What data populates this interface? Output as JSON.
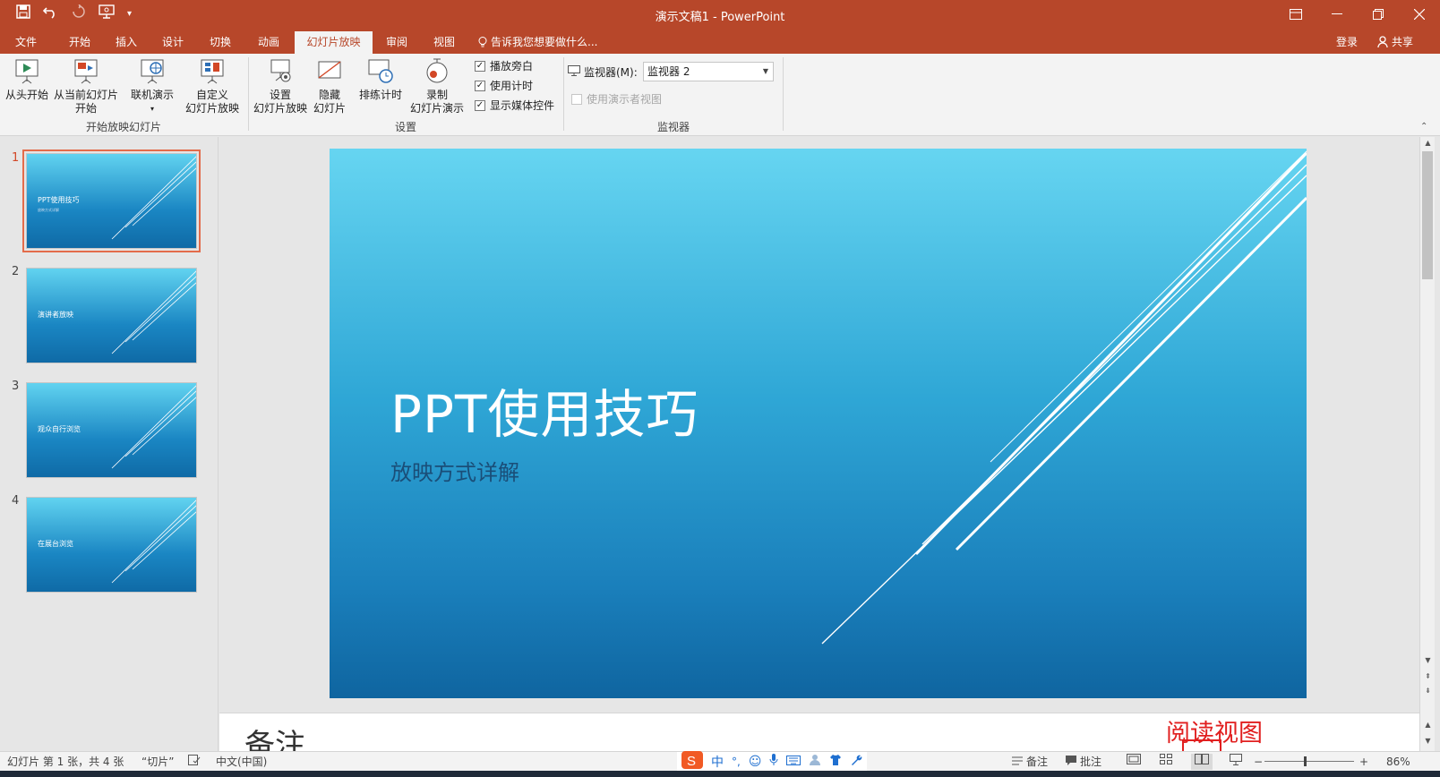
{
  "window": {
    "title": "演示文稿1 - PowerPoint",
    "qat_icons": [
      "save-icon",
      "undo-icon",
      "redo-icon",
      "present-icon",
      "customize-qat-icon"
    ]
  },
  "tabs": {
    "items": [
      "文件",
      "开始",
      "插入",
      "设计",
      "切换",
      "动画",
      "幻灯片放映",
      "审阅",
      "视图"
    ],
    "active": "幻灯片放映",
    "tell_me": "告诉我您想要做什么...",
    "login": "登录",
    "share": "共享"
  },
  "ribbon": {
    "group_start": {
      "label": "开始放映幻灯片",
      "from_beginning": "从头开始",
      "from_current_line1": "从当前幻灯片",
      "from_current_line2": "开始",
      "online": "联机演示",
      "custom_line1": "自定义",
      "custom_line2": "幻灯片放映"
    },
    "group_setup": {
      "label": "设置",
      "setup_line1": "设置",
      "setup_line2": "幻灯片放映",
      "hide_line1": "隐藏",
      "hide_line2": "幻灯片",
      "rehearse": "排练计时",
      "record_line1": "录制",
      "record_line2": "幻灯片演示",
      "check_narration": "播放旁白",
      "check_timing": "使用计时",
      "check_media": "显示媒体控件"
    },
    "group_monitor": {
      "label": "监视器",
      "monitor_label": "监视器(M):",
      "monitor_value": "监视器 2",
      "presenter_view": "使用演示者视图"
    }
  },
  "slides": [
    {
      "number": "1",
      "title": "PPT使用技巧",
      "subtitle": "放映方式详解"
    },
    {
      "number": "2",
      "title": "演讲者放映",
      "subtitle": ""
    },
    {
      "number": "3",
      "title": "观众自行浏览",
      "subtitle": ""
    },
    {
      "number": "4",
      "title": "在展台浏览",
      "subtitle": ""
    }
  ],
  "current_slide": {
    "title": "PPT使用技巧",
    "subtitle": "放映方式详解"
  },
  "notes": {
    "text": "备注"
  },
  "annotation": {
    "text": "阅读视图",
    "color": "#e11f1f"
  },
  "statusbar": {
    "slide_info": "幻灯片 第 1 张，共 4 张",
    "theme": "“切片”",
    "language": "中文(中国)",
    "notes": "备注",
    "comments": "批注",
    "zoom": "86%",
    "ime_chars": [
      "中",
      "°,"
    ]
  },
  "colors": {
    "accent": "#b7472a",
    "active_tab_text": "#b7472a",
    "selected_thumb": "#e36c4b"
  }
}
